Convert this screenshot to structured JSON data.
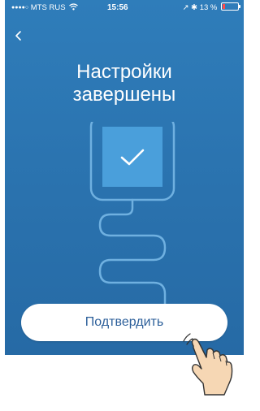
{
  "status_bar": {
    "signal": "●●●●○",
    "carrier": "MTS RUS",
    "wifi_icon": "wifi-icon",
    "time": "15:56",
    "right": "↗ ✱ 13 %",
    "battery_icon": "battery-icon"
  },
  "nav": {
    "back_icon": "chevron-left-icon"
  },
  "title": {
    "line1": "Настройки",
    "line2": "завершены"
  },
  "illustration": {
    "icon": "device-checkmark-icon"
  },
  "confirm_button": {
    "label": "Подтвердить"
  },
  "overlay": {
    "icon": "tapping-hand-icon"
  },
  "colors": {
    "background": "#2a72ae",
    "button_text": "#2c5f9a",
    "outline": "#6fb0e0",
    "check_square": "#4a9fdb"
  }
}
